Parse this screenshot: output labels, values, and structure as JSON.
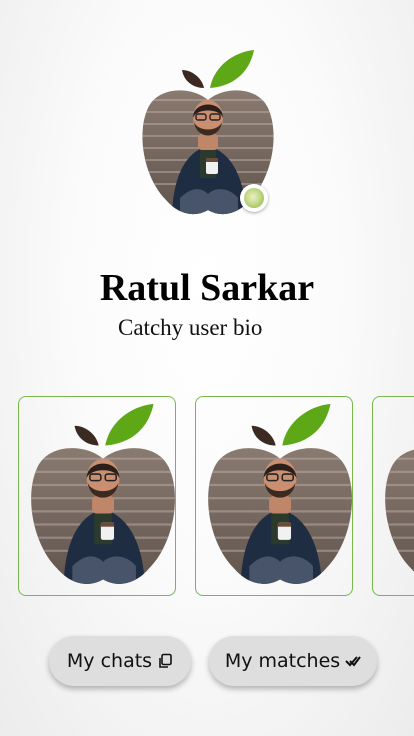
{
  "profile": {
    "name": "Ratul Sarkar",
    "bio": "Catchy user bio",
    "status_icon": "online-status-icon"
  },
  "matches": {
    "cards": [
      {
        "icon": "apple-photo-frame"
      },
      {
        "icon": "apple-photo-frame"
      },
      {
        "icon": "apple-photo-frame"
      }
    ]
  },
  "actions": {
    "chats_label": "My chats",
    "chats_icon": "copy-icon",
    "matches_label": "My matches",
    "matches_icon": "double-check-icon"
  },
  "colors": {
    "leaf": "#5ea818",
    "stem": "#3a2a22",
    "card_border": "#78b84a",
    "button_bg": "#dedede"
  }
}
